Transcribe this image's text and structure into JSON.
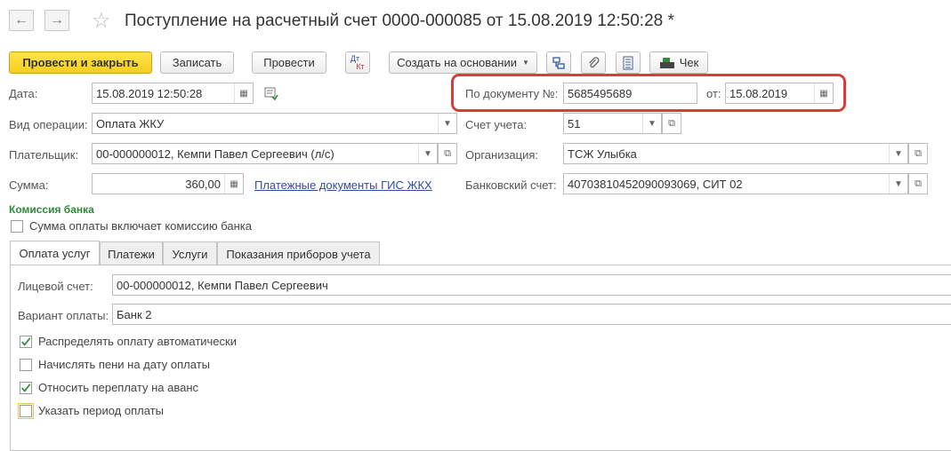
{
  "window": {
    "title": "Поступление на расчетный счет 0000-000085 от 15.08.2019 12:50:28 *"
  },
  "toolbar": {
    "post_and_close": "Провести и закрыть",
    "save": "Записать",
    "post": "Провести",
    "dt_kt_top": "Дт",
    "dt_kt_bottom": "Кт",
    "create_based_on": "Создать на основании",
    "receipt": "Чек"
  },
  "form": {
    "date_label": "Дата:",
    "date_value": "15.08.2019 12:50:28",
    "doc_number_label": "По документу №:",
    "doc_number_value": "5685495689",
    "doc_date_label": "от:",
    "doc_date_value": "15.08.2019",
    "operation_label": "Вид операции:",
    "operation_value": "Оплата ЖКУ",
    "account_label": "Счет учета:",
    "account_value": "51",
    "payer_label": "Плательщик:",
    "payer_value": "00-000000012, Кемпи Павел Сергеевич (л/с)",
    "organization_label": "Организация:",
    "organization_value": "ТСЖ Улыбка",
    "sum_label": "Сумма:",
    "sum_value": "360,00",
    "gis_link": "Платежные документы ГИС ЖКХ",
    "bank_account_label": "Банковский счет:",
    "bank_account_value": "40703810452090093069, СИТ 02"
  },
  "bank_commission": {
    "heading": "Комиссия банка",
    "includes_commission_label": "Сумма оплаты включает комиссию банка",
    "includes_commission_checked": false
  },
  "tabs": [
    {
      "label": "Оплата услуг",
      "active": true
    },
    {
      "label": "Платежи",
      "active": false
    },
    {
      "label": "Услуги",
      "active": false
    },
    {
      "label": "Показания приборов учета",
      "active": false
    }
  ],
  "services_tab": {
    "personal_account_label": "Лицевой счет:",
    "personal_account_value": "00-000000012, Кемпи Павел Сергеевич",
    "payment_variant_label": "Вариант оплаты:",
    "payment_variant_value": "Банк 2",
    "checkboxes": [
      {
        "label": "Распределять оплату автоматически",
        "checked": true
      },
      {
        "label": "Начислять пени на дату оплаты",
        "checked": false
      },
      {
        "label": "Относить переплату на аванс",
        "checked": true
      },
      {
        "label": "Указать период оплаты",
        "checked": false
      }
    ]
  },
  "colors": {
    "primary_button": "#f6cf1c",
    "highlight_frame": "#d93c3c",
    "section_heading": "#2e8b3a",
    "link": "#2d4f9c",
    "checkmark": "#2e8b3a"
  }
}
